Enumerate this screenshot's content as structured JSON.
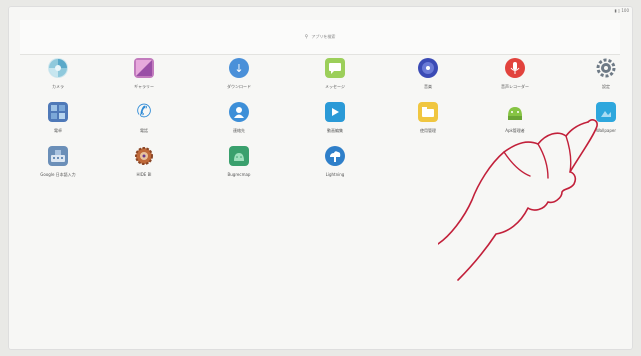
{
  "status": {
    "icons": "▮ ▯ 100"
  },
  "search": {
    "placeholder": "アプリを検索"
  },
  "apps": [
    {
      "label": "カメラ",
      "icon": "camera-lens-icon",
      "color": "#7dbfd6"
    },
    {
      "label": "ギャラリー",
      "icon": "gallery-icon",
      "color": "#b66fb0"
    },
    {
      "label": "ダウンロード",
      "icon": "download-icon",
      "color": "#4a90d9"
    },
    {
      "label": "メッセージ",
      "icon": "message-icon",
      "color": "#9ccf5a"
    },
    {
      "label": "音楽",
      "icon": "music-icon",
      "color": "#3b4bb5"
    },
    {
      "label": "音声レコーダー",
      "icon": "microphone-icon",
      "color": "#e2433d"
    },
    {
      "label": "設定",
      "icon": "gear-icon",
      "color": "#6e7a86"
    },
    {
      "label": "電卓",
      "icon": "calculator-icon",
      "color": "#4f79b8"
    },
    {
      "label": "電話",
      "icon": "phone-icon",
      "color": "#2d8ad6"
    },
    {
      "label": "連絡先",
      "icon": "contacts-icon",
      "color": "#3d8fd8"
    },
    {
      "label": "動画編集",
      "icon": "video-icon",
      "color": "#2b9ad7"
    },
    {
      "label": "使用管理",
      "icon": "file-manager-icon",
      "color": "#f0c640"
    },
    {
      "label": "Apk管理者",
      "icon": "android-tools-icon",
      "color": "#86c443"
    },
    {
      "label": "Wallpaper",
      "icon": "wallpaper-icon",
      "color": "#2ea7dd"
    },
    {
      "label": "Google 日本語入力",
      "icon": "keyboard-icon",
      "color": "#6b8fb8"
    },
    {
      "label": "HIDE BI",
      "icon": "hide-gear-icon",
      "color": "#c06a3a"
    },
    {
      "label": "Bugrecmap",
      "icon": "android-box-icon",
      "color": "#3aa06d"
    },
    {
      "label": "Lightning",
      "icon": "cloud-browser-icon",
      "color": "#2f7fc9"
    }
  ]
}
